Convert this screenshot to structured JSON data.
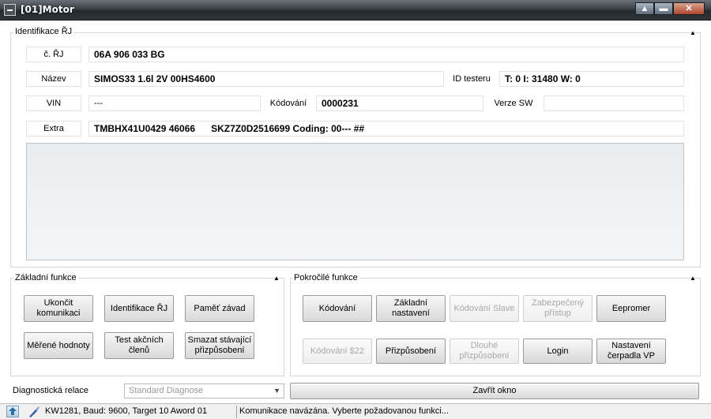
{
  "window": {
    "title": "[01]Motor",
    "minimize_glyph": "▲",
    "restore_glyph": "▬",
    "close_glyph": "✕"
  },
  "identification": {
    "group_label": "Identifikace ŘJ",
    "collapse_glyph": "▲",
    "cislo_label": "č. ŘJ",
    "cislo_value": "06A 906 033 BG",
    "nazev_label": "Název",
    "nazev_value": "SIMOS33 1.6l 2V 00HS4600",
    "tester_label": "ID testeru",
    "tester_value": "T: 0 I: 31480 W: 0",
    "vin_label": "VIN",
    "vin_value": "---",
    "kodovani_label": "Kódování",
    "kodovani_value": "0000231",
    "verze_label": "Verze SW",
    "verze_value": "",
    "extra_label": "Extra",
    "extra_value": "TMBHX41U0429 46066      SKZ7Z0D2516699 Coding: 00--- ##"
  },
  "basic": {
    "group_label": "Základní funkce",
    "collapse_glyph": "▲",
    "buttons": [
      "Ukončit komunikaci",
      "Identifikace ŘJ",
      "Paměť závad",
      "Měřené hodnoty",
      "Test akčních členů",
      "Smazat stávající přizpůsobení"
    ]
  },
  "advanced": {
    "group_label": "Pokročilé funkce",
    "collapse_glyph": "▲",
    "buttons": [
      "Kódování",
      "Základní nastavení",
      "Kódování Slave",
      "Zabezpečený přístup",
      "Eepromer",
      "Kódování $22",
      "Přizpůsobení",
      "Dlouhé přizpůsobení",
      "Login",
      "Nastavení čerpadla VP"
    ]
  },
  "session": {
    "label": "Diagnostická relace",
    "value": "Standard Diagnose",
    "arrow_glyph": "▼"
  },
  "close_button": "Zavřít okno",
  "status": {
    "connection": "KW1281, Baud: 9600, Target 10 Aword 01",
    "message": "Komunikace navázána. Vyberte požadovanou funkci..."
  }
}
